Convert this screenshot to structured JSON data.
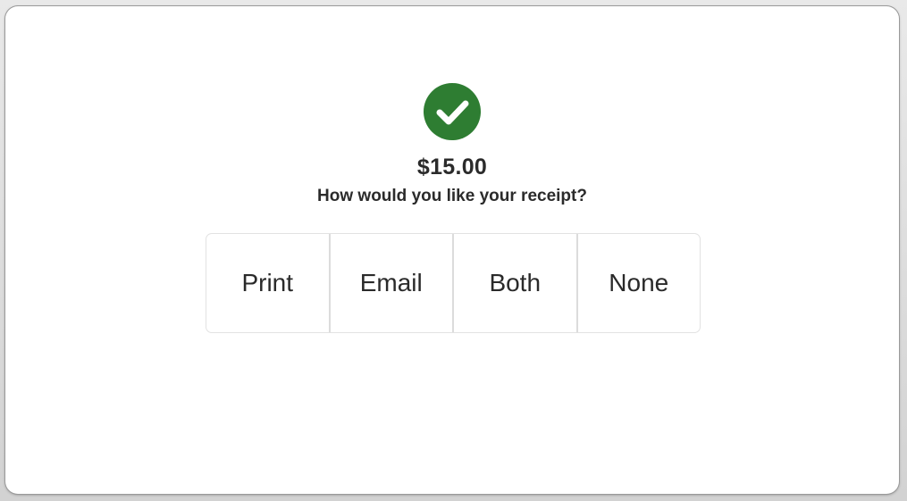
{
  "payment": {
    "amount": "$15.00",
    "prompt": "How would you like your receipt?",
    "status_icon": "checkmark-circle-icon",
    "accent_color": "#2e7d32"
  },
  "receipt_options": [
    {
      "label": "Print"
    },
    {
      "label": "Email"
    },
    {
      "label": "Both"
    },
    {
      "label": "None"
    }
  ]
}
